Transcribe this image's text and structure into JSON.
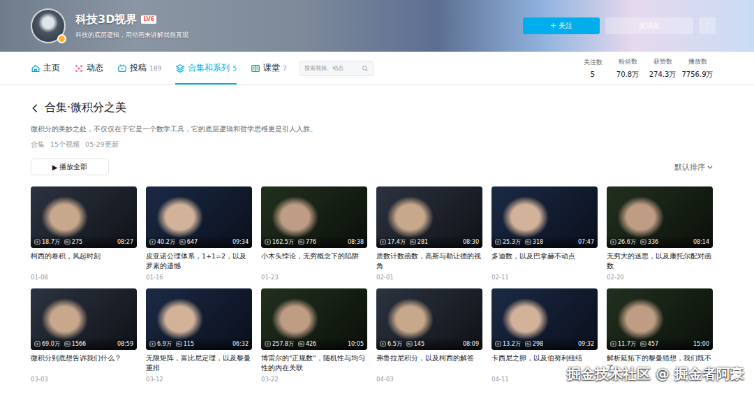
{
  "profile": {
    "name": "科技3D视界",
    "level": "LV6",
    "bio": "科技的底层逻辑，用动画来讲解就很直观",
    "follow_button": "+ 关注",
    "message_button": "发消息",
    "more_button": "⋮"
  },
  "tabs": [
    {
      "label": "主页",
      "count": "",
      "selected": false
    },
    {
      "label": "动态",
      "count": "",
      "selected": false
    },
    {
      "label": "投稿",
      "count": "189",
      "selected": false
    },
    {
      "label": "合集和系列",
      "count": "5",
      "selected": true
    },
    {
      "label": "课堂",
      "count": "7",
      "selected": false
    }
  ],
  "search": {
    "placeholder": "搜索视频、动态"
  },
  "stats": [
    {
      "label": "关注数",
      "value": "5"
    },
    {
      "label": "粉丝数",
      "value": "70.8万"
    },
    {
      "label": "获赞数",
      "value": "274.3万"
    },
    {
      "label": "播放数",
      "value": "7756.9万"
    }
  ],
  "collection": {
    "title": "合集·微积分之美",
    "description": "微积分的美妙之处，不仅仅在于它是一个数学工具，它的底层逻辑和哲学思维更是引人入胜。",
    "meta": [
      "合集",
      "15个视频",
      "05-29更新"
    ],
    "play_all": {
      "icon": "▶",
      "label": "播放全部"
    },
    "sort": "默认排序"
  },
  "videos": [
    {
      "views": "18.7万",
      "danmaku": "275",
      "duration": "08:27",
      "title": "柯西的卷积，风起时刻",
      "date": "01-08"
    },
    {
      "views": "40.2万",
      "danmaku": "647",
      "duration": "09:34",
      "title": "皮亚诺公理体系，1+1=2，以及罗素的遗憾",
      "date": "01-16"
    },
    {
      "views": "162.5万",
      "danmaku": "776",
      "duration": "08:38",
      "title": "小木头悖论，无穷概念下的陷阱",
      "date": "01-23"
    },
    {
      "views": "17.4万",
      "danmaku": "281",
      "duration": "08:30",
      "title": "质数计数函数，高斯与勒让德的视角",
      "date": "02-01"
    },
    {
      "views": "25.3万",
      "danmaku": "318",
      "duration": "07:47",
      "title": "多迪数，以及巴拿赫不动点",
      "date": "02-11"
    },
    {
      "views": "26.6万",
      "danmaku": "336",
      "duration": "08:14",
      "title": "无穷大的迷思，以及康托尔配对函数",
      "date": "02-20"
    },
    {
      "views": "69.0万",
      "danmaku": "1566",
      "duration": "08:59",
      "title": "微积分到底想告诉我们什么？",
      "date": "03-03"
    },
    {
      "views": "6.9万",
      "danmaku": "115",
      "duration": "06:32",
      "title": "无限矩阵，富比尼定理，以及黎曼重排",
      "date": "03-12"
    },
    {
      "views": "257.8万",
      "danmaku": "426",
      "duration": "10:05",
      "title": "博雷尔的\"正规数\"，随机性与均匀性的内在关联",
      "date": "03-22"
    },
    {
      "views": "6.5万",
      "danmaku": "145",
      "duration": "08:09",
      "title": "弗鲁拉尼积分，以及柯西的解答",
      "date": "04-03"
    },
    {
      "views": "13.2万",
      "danmaku": "298",
      "duration": "09:32",
      "title": "卡西尼之卵，以及伯努利纽结",
      "date": "04-11"
    },
    {
      "views": "11.7万",
      "danmaku": "457",
      "duration": "15:00",
      "title": "解析延拓下的黎曼猜想，我们既不了",
      "date": "04-24"
    }
  ],
  "watermark": "掘金技术社区 @ 掘金者阿豪"
}
